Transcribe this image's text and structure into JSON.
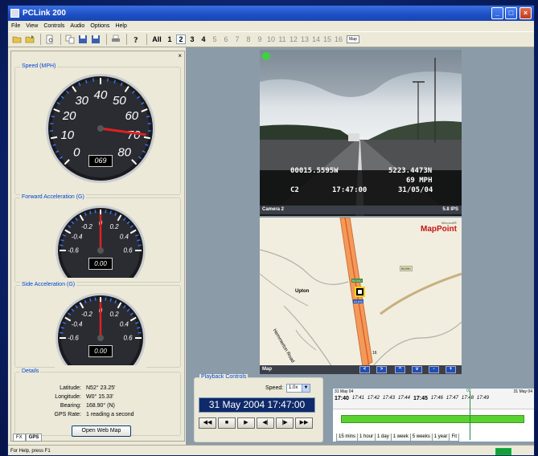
{
  "window": {
    "title": "PCLink 200"
  },
  "menu": [
    "File",
    "View",
    "Controls",
    "Audio",
    "Options",
    "Help"
  ],
  "toolbar": {
    "icons": [
      "open-folder-icon",
      "open-folder-icon",
      "print-preview-icon",
      "copy-icon",
      "save-icon",
      "save-icon",
      "print-icon",
      "help-icon"
    ],
    "cameras": [
      "All",
      "1",
      "2",
      "3",
      "4",
      "5",
      "6",
      "7",
      "8",
      "9",
      "10",
      "11",
      "12",
      "13",
      "14",
      "15",
      "16"
    ],
    "map_label": "Map"
  },
  "speed": {
    "title": "Speed (MPH)",
    "ticks": [
      "0",
      "10",
      "20",
      "30",
      "40",
      "50",
      "60",
      "70",
      "80"
    ],
    "readout": "069",
    "value": 69
  },
  "forward_accel": {
    "title": "Forward Acceleration (G)",
    "ticks": [
      "-0.6",
      "-0.4",
      "-0.2",
      "0",
      "0.2",
      "0.4",
      "0.6"
    ],
    "readout": "0.00",
    "value": 0
  },
  "side_accel": {
    "title": "Side Acceleration (G)",
    "ticks": [
      "-0.6",
      "-0.4",
      "-0.2",
      "0",
      "0.2",
      "0.4",
      "0.6"
    ],
    "readout": "0.00",
    "value": 0
  },
  "details": {
    "title": "Details",
    "latitude_label": "Latitude:",
    "latitude": "N52° 23.25'",
    "longitude_label": "Longitude:",
    "longitude": "W0° 15.33'",
    "bearing_label": "Bearing:",
    "bearing": "168.90° (N)",
    "gps_label": "GPS Rate:",
    "gps_rate": "1 reading a second",
    "button": "Open Web Map"
  },
  "left_tabs": [
    "FX",
    "GPS"
  ],
  "camera": {
    "overlay_line1_left": "00015.5595W",
    "overlay_line1_right": "5223.4473N",
    "overlay_line2_right": "69 MPH",
    "overlay_line3_left": "C2",
    "overlay_line3_mid": "17:47:00",
    "overlay_line3_right": "31/05/04",
    "caption": "Camera 2",
    "fps": "5.8 IPS"
  },
  "map": {
    "brand_small": "Microsoft®",
    "brand": "MapPoint",
    "town": "Upton",
    "road_label": "Hemmerton Road",
    "shield1": "B1040",
    "shield2": "A1(M)",
    "shield3": "B1090",
    "junction": "16",
    "caption": "Map",
    "nav_buttons": [
      "<",
      ">",
      "^",
      "v",
      "-",
      "+"
    ]
  },
  "playback": {
    "title": "Playback Controls",
    "speed_label": "Speed:",
    "speed_value": "1.0x",
    "datetime": "31 May 2004  17:47:00",
    "buttons": [
      "rewind-icon",
      "stop-icon",
      "play-icon",
      "step-back-icon",
      "step-forward-icon",
      "fast-forward-icon"
    ]
  },
  "timeline": {
    "date_left": "31 May 04",
    "date_right": "31 May 04",
    "times": [
      "17:40",
      "17:41",
      "17:42",
      "17:43",
      "17:44",
      "17:45",
      "17:46",
      "17:47",
      "17:48",
      "17:49"
    ],
    "cursor_label": "00",
    "tabs": [
      "15 mins",
      "1 hour",
      "1 day",
      "1 week",
      "5 weeks",
      "1 year",
      "Fit"
    ]
  },
  "status": {
    "text": "For Help, press F1"
  }
}
